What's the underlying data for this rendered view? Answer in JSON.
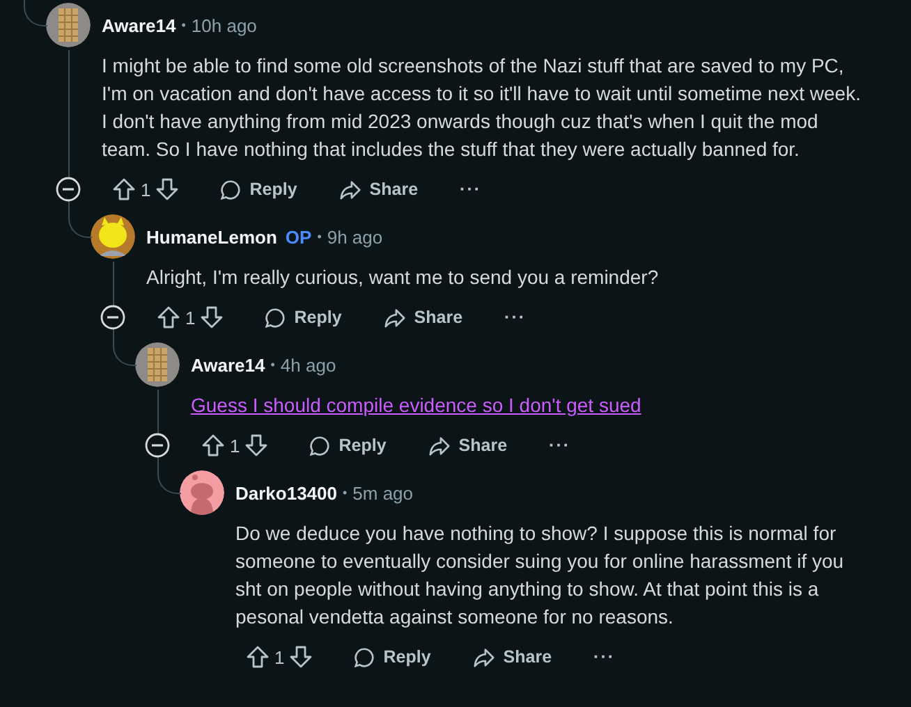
{
  "comments": [
    {
      "author": "Aware14",
      "avatar": {
        "kind": "waffle"
      },
      "separator": "•",
      "time": "10h ago",
      "body": "I might be able to find some old screenshots of the Nazi stuff that are saved to my PC, I'm on vacation and don't have access to it so it'll have to wait until sometime next week. I don't have anything from mid 2023 onwards though cuz that's when I quit the mod team. So I have nothing that includes the stuff that they were actually banned for.",
      "link": false,
      "votes": "1",
      "actions": [
        "Reply",
        "Share",
        "···"
      ],
      "expanded": true,
      "children": [
        {
          "author": "HumaneLemon",
          "badge": "OP",
          "avatar": {
            "kind": "lemon"
          },
          "separator": "•",
          "time": "9h ago",
          "body": "Alright, I'm really curious, want me to send you a reminder?",
          "link": false,
          "votes": "1",
          "actions": [
            "Reply",
            "Share",
            "···"
          ],
          "expanded": true,
          "children": [
            {
              "author": "Aware14",
              "avatar": {
                "kind": "waffle"
              },
              "separator": "•",
              "time": "4h ago",
              "body": "Guess I should compile evidence so I don't get sued",
              "link": true,
              "votes": "1",
              "actions": [
                "Reply",
                "Share",
                "···"
              ],
              "expanded": true,
              "children": [
                {
                  "author": "Darko13400",
                  "avatar": {
                    "kind": "snoo"
                  },
                  "separator": "•",
                  "time": "5m ago",
                  "body": "Do we deduce you have nothing to show? I suppose this is normal for someone to eventually consider suing you for online harassment if you sht on people without having anything to show. At that point this is a pesonal vendetta against someone for no reasons.",
                  "link": false,
                  "votes": "1",
                  "actions": [
                    "Reply",
                    "Share",
                    "···"
                  ]
                }
              ]
            }
          ]
        }
      ]
    }
  ]
}
